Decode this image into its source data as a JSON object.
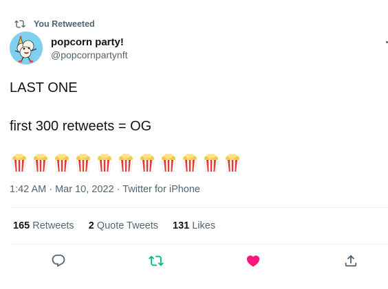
{
  "retweet_header": {
    "label": "You Retweeted",
    "icon": "retweet-icon"
  },
  "author": {
    "display_name": "popcorn party!",
    "handle": "@popcornpartynft",
    "avatar_icon": "popcorn-mascot-avatar"
  },
  "tweet": {
    "line1": "LAST ONE",
    "line2": "first 300 retweets = OG",
    "emoji_icon": "popcorn-emoji",
    "emoji_count": 11
  },
  "meta": {
    "time": "1:42 AM",
    "separator": " · ",
    "date": "Mar 10, 2022",
    "source": "Twitter for iPhone"
  },
  "stats": {
    "retweets": {
      "count": "165",
      "label": " Retweets"
    },
    "quotes": {
      "count": "2",
      "label": " Quote Tweets"
    },
    "likes": {
      "count": "131",
      "label": " Likes"
    }
  },
  "actions": {
    "reply_icon": "reply-icon",
    "retweet_icon": "retweet-icon",
    "like_icon": "heart-icon",
    "share_icon": "share-icon"
  },
  "colors": {
    "text_primary": "#0f1419",
    "text_secondary": "#536471",
    "retweet_active": "#00ba7c",
    "like_active": "#f91880",
    "divider": "#eff3f4"
  }
}
